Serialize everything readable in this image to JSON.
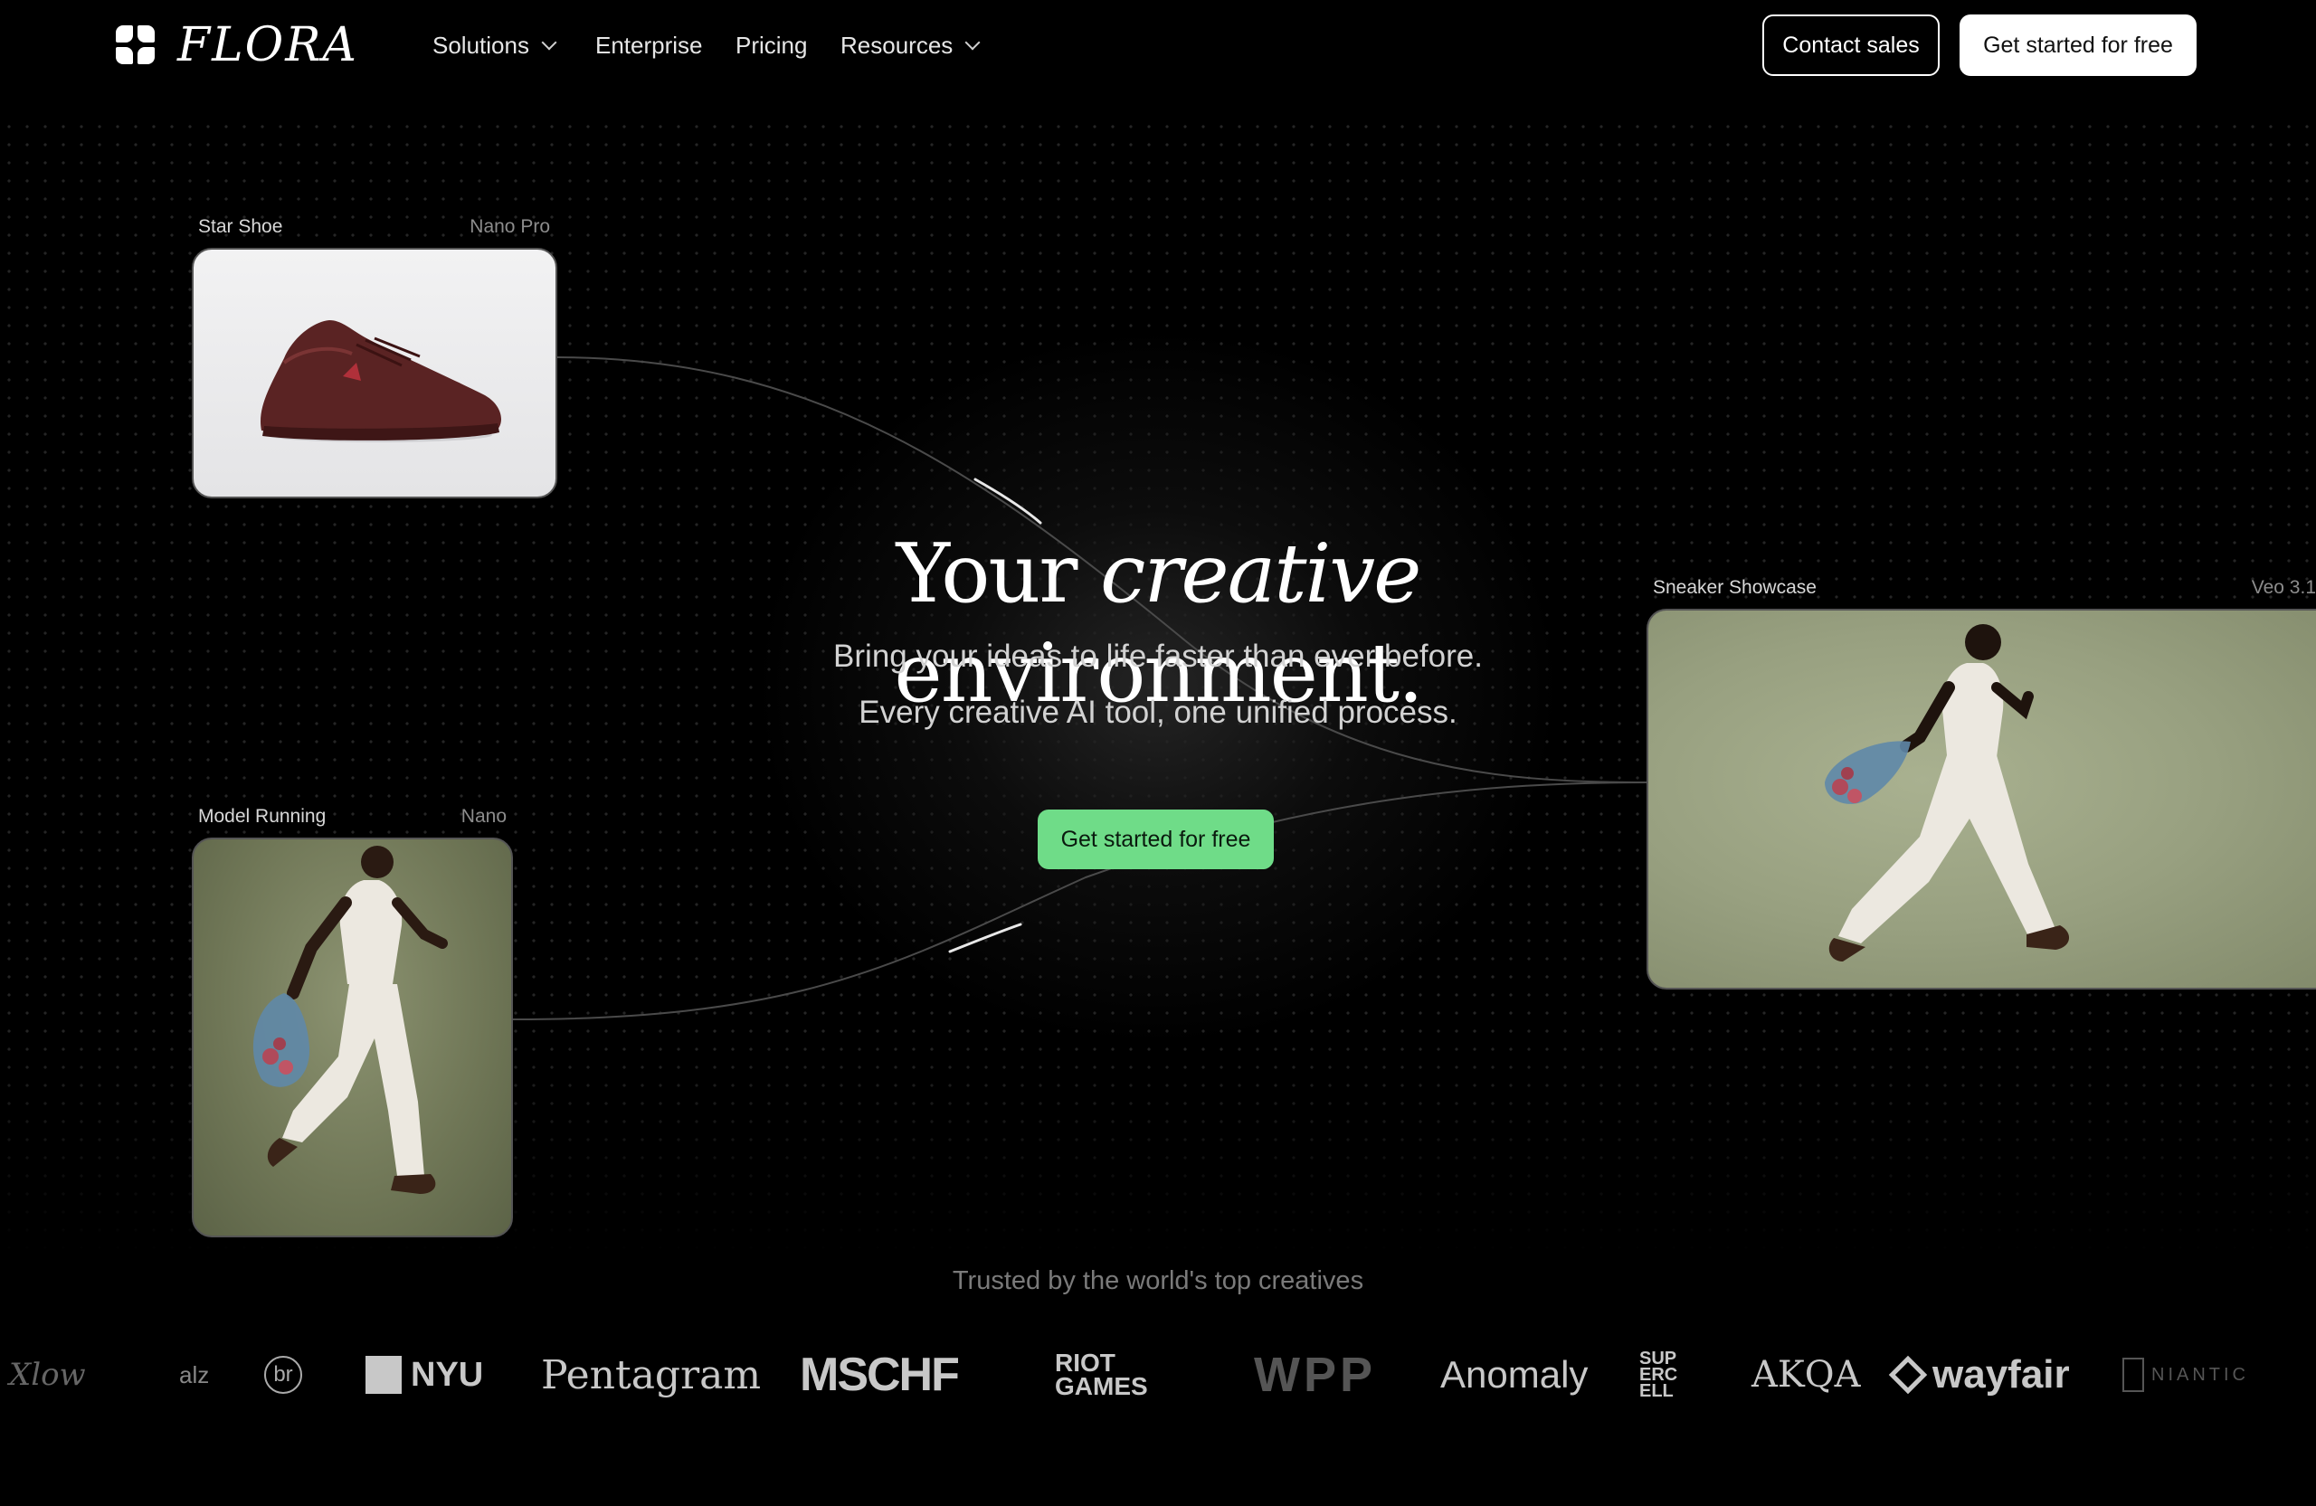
{
  "nav": {
    "logo_text": "FLORA",
    "links": [
      {
        "label": "Solutions",
        "has_dropdown": true
      },
      {
        "label": "Enterprise",
        "has_dropdown": false
      },
      {
        "label": "Pricing",
        "has_dropdown": false
      },
      {
        "label": "Resources",
        "has_dropdown": true
      }
    ],
    "contact_label": "Contact sales",
    "get_started_label": "Get started for free"
  },
  "nodes": [
    {
      "title": "Star Shoe",
      "model": "Nano Pro"
    },
    {
      "title": "Model Running",
      "model": "Nano"
    },
    {
      "title": "Sneaker Showcase",
      "model": "Veo 3.1"
    }
  ],
  "hero": {
    "title_before": "Your",
    "title_italic": "creative",
    "title_after": "environment.",
    "subtitle_1": "Bring your ideas to life faster than ever before.",
    "subtitle_2": "Every creative AI tool, one unified process.",
    "cta_label": "Get started for free",
    "cta_color": "#6fdc88"
  },
  "trusted": {
    "heading": "Trusted by the world's top creatives",
    "brands": [
      "NYU",
      "Pentagram",
      "MSCHF",
      "RIOT GAMES",
      "WPP",
      "Anomaly",
      "SUP ERC ELL",
      "AKQA",
      "wayfair",
      "NIANTIC"
    ]
  }
}
